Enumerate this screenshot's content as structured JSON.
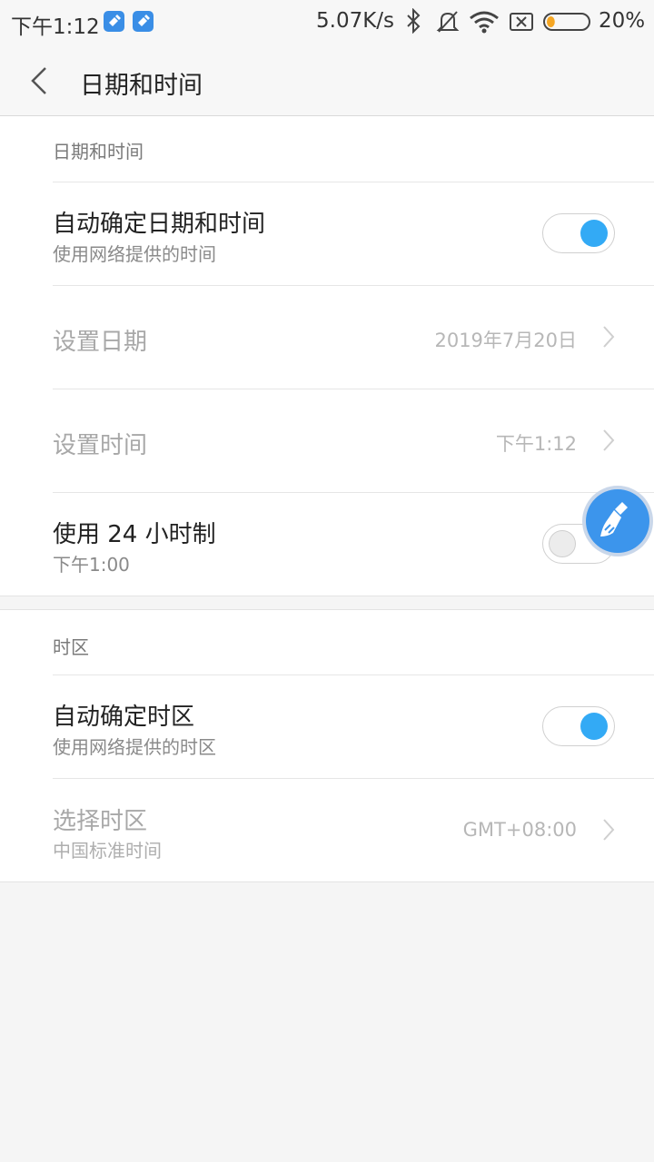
{
  "status_bar": {
    "time": "下午1:12",
    "net_speed": "5.07K/s",
    "battery_pct": "20%",
    "battery_level": 0.2,
    "icons": [
      "app-notification-icon",
      "app-notification-icon",
      "bluetooth-icon",
      "mute-icon",
      "wifi-icon",
      "no-sim-icon",
      "battery-icon"
    ]
  },
  "header": {
    "back_icon": "chevron-left-icon",
    "title": "日期和时间"
  },
  "section_datetime": {
    "header": "日期和时间",
    "auto_datetime": {
      "title": "自动确定日期和时间",
      "subtitle": "使用网络提供的时间",
      "enabled": true
    },
    "set_date": {
      "title": "设置日期",
      "value": "2019年7月20日"
    },
    "set_time": {
      "title": "设置时间",
      "value": "下午1:12"
    },
    "use_24h": {
      "title": "使用 24 小时制",
      "subtitle": "下午1:00",
      "enabled": false
    }
  },
  "section_timezone": {
    "header": "时区",
    "auto_timezone": {
      "title": "自动确定时区",
      "subtitle": "使用网络提供的时区",
      "enabled": true
    },
    "select_timezone": {
      "title": "选择时区",
      "subtitle": "中国标准时间",
      "value": "GMT+08:00"
    }
  },
  "floating_ball": {
    "icon": "broom-icon"
  },
  "colors": {
    "accent": "#33aaf5",
    "background": "#f5f5f5",
    "dim_text": "#a8a8a8"
  }
}
